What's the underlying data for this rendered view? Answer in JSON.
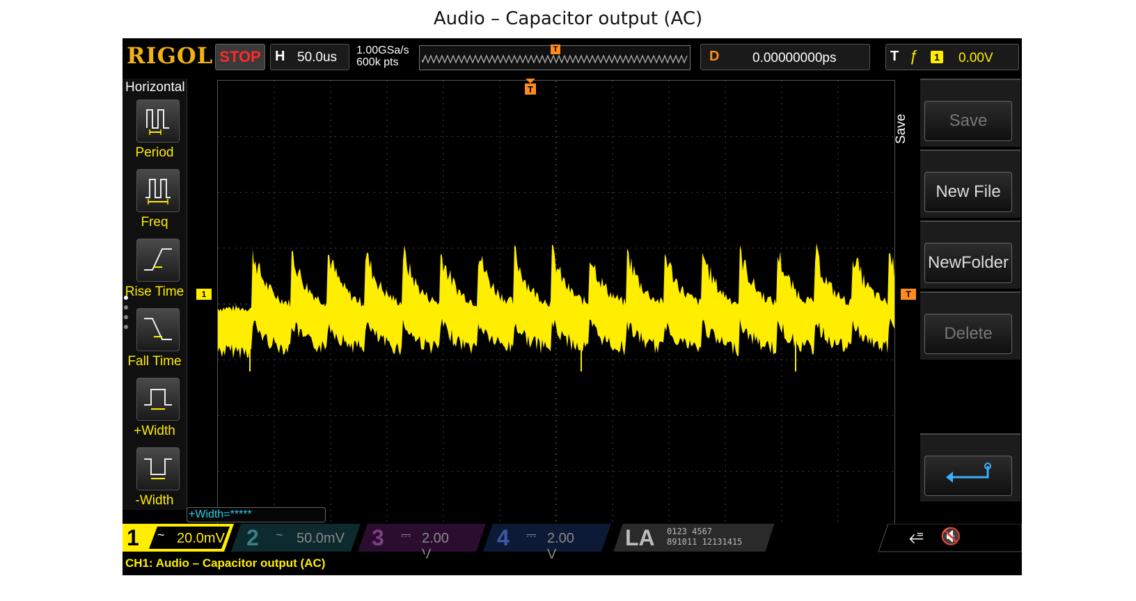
{
  "slide_title": "Audio – Capacitor output (AC)",
  "topbar": {
    "brand": "RIGOL",
    "run_state": "STOP",
    "h_label": "H",
    "timebase": "50.0us",
    "sample_rate": "1.00GSa/s",
    "memory_depth": "600k pts",
    "memory_trigger_marker": "T",
    "d_label": "D",
    "delay": "0.00000000ps",
    "t_label": "T",
    "trigger_channel": "1",
    "trigger_level": "0.00V"
  },
  "left_menu": {
    "title": "Horizontal",
    "items": [
      {
        "label": "Period",
        "icon": "period-icon"
      },
      {
        "label": "Freq",
        "icon": "freq-icon"
      },
      {
        "label": "Rise Time",
        "icon": "rise-time-icon"
      },
      {
        "label": "Fall Time",
        "icon": "fall-time-icon"
      },
      {
        "label": "+Width",
        "icon": "positive-width-icon"
      },
      {
        "label": "-Width",
        "icon": "negative-width-icon"
      }
    ]
  },
  "screen": {
    "ch1_marker": "1",
    "trigger_marker": "T",
    "trigger_level_marker": "T"
  },
  "right_menu": {
    "title": "Save",
    "buttons": [
      {
        "label": "Save",
        "enabled": false
      },
      {
        "label": "New File",
        "enabled": true
      },
      {
        "label": "NewFolder",
        "enabled": true
      },
      {
        "label": "Delete",
        "enabled": false
      }
    ],
    "return_icon": "return-arrow-icon"
  },
  "measurement": "+Width=*****",
  "channels": [
    {
      "num": "1",
      "coupling": "~",
      "scale": "20.0mV",
      "color": "#ffee00",
      "active": true
    },
    {
      "num": "2",
      "coupling": "~",
      "scale": "50.0mV",
      "color": "#22d3ee",
      "active": false
    },
    {
      "num": "3",
      "coupling": "⎓",
      "scale": "2.00 V",
      "color": "#e040fb",
      "active": false
    },
    {
      "num": "4",
      "coupling": "⎓",
      "scale": "2.00 V",
      "color": "#3b82f6",
      "active": false
    }
  ],
  "la": {
    "label": "LA",
    "row1": "0123 4567",
    "row2": "891011 12131415"
  },
  "status_icons": {
    "usb": "usb-icon",
    "sound": "mute-icon"
  },
  "caption": "CH1: Audio – Capacitor output (AC)",
  "colors": {
    "ch1": "#ffee00",
    "trigger": "#ff8c1a",
    "brand": "#f2b20f",
    "stop": "#ff2a2a"
  }
}
